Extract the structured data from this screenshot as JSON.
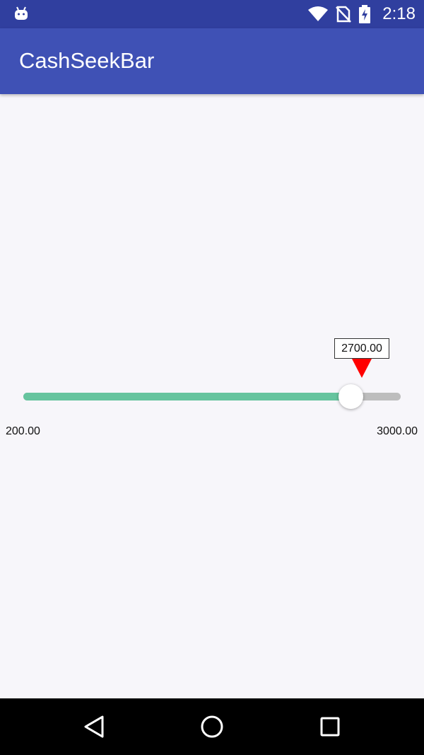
{
  "status_bar": {
    "time": "2:18",
    "icons": [
      "android-icon",
      "wifi-icon",
      "no-sim-icon",
      "battery-charging-icon"
    ]
  },
  "app_bar": {
    "title": "CashSeekBar"
  },
  "seekbar": {
    "current_value": "2700.00",
    "min_label": "200.00",
    "max_label": "3000.00",
    "min": 200,
    "max": 3000,
    "value": 2700,
    "fill_color": "#66c49e",
    "track_color": "#bdbdbd",
    "pointer_color": "#ff0000"
  },
  "nav_bar": {
    "icons": [
      "back-icon",
      "home-icon",
      "recents-icon"
    ]
  },
  "colors": {
    "status_bar": "#303f9f",
    "app_bar": "#3f51b5",
    "background": "#f7f6fa"
  }
}
